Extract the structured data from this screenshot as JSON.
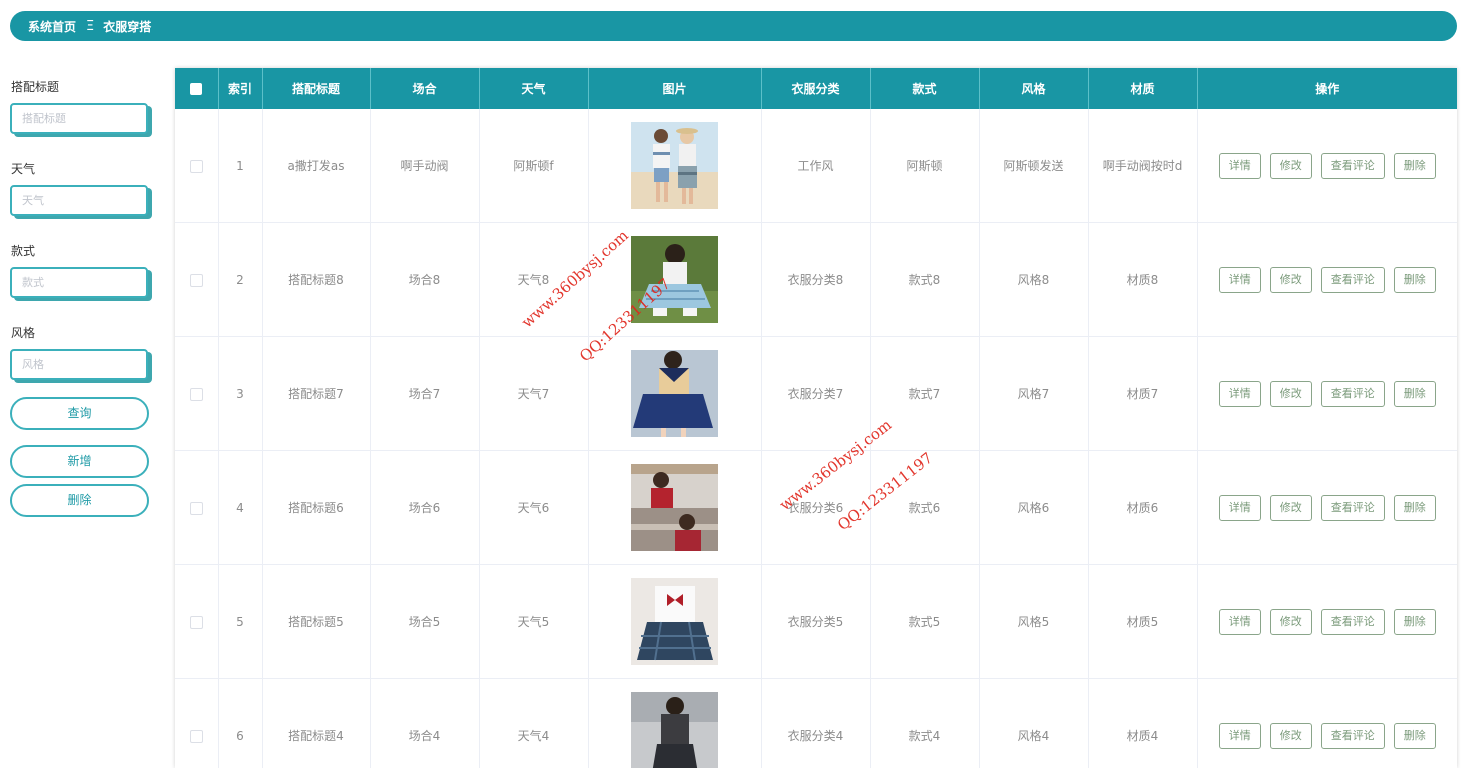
{
  "breadcrumb": {
    "home": "系统首页",
    "separator": "Ξ",
    "current": "衣服穿搭"
  },
  "filters": [
    {
      "label": "搭配标题",
      "placeholder": "搭配标题"
    },
    {
      "label": "天气",
      "placeholder": "天气"
    },
    {
      "label": "款式",
      "placeholder": "款式"
    },
    {
      "label": "风格",
      "placeholder": "风格"
    }
  ],
  "buttons": {
    "search": "查询",
    "add": "新增",
    "delete": "删除"
  },
  "table": {
    "headers": [
      "索引",
      "搭配标题",
      "场合",
      "天气",
      "图片",
      "衣服分类",
      "款式",
      "风格",
      "材质",
      "操作"
    ],
    "actions": {
      "detail": "详情",
      "edit": "修改",
      "comments": "查看评论",
      "remove": "删除"
    },
    "rows": [
      {
        "index": "1",
        "title": "a撒打发as",
        "occasion": "啊手动阀",
        "weather": "阿斯顿f",
        "category": "工作风",
        "style": "阿斯顿",
        "fashion": "阿斯顿发送",
        "material": "啊手动阀按时d",
        "image": "couple-photo"
      },
      {
        "index": "2",
        "title": "搭配标题8",
        "occasion": "场合8",
        "weather": "天气8",
        "category": "衣服分类8",
        "style": "款式8",
        "fashion": "风格8",
        "material": "材质8",
        "image": "plaid-skirt-photo"
      },
      {
        "index": "3",
        "title": "搭配标题7",
        "occasion": "场合7",
        "weather": "天气7",
        "category": "衣服分类7",
        "style": "款式7",
        "fashion": "风格7",
        "material": "材质7",
        "image": "sailor-uniform-photo"
      },
      {
        "index": "4",
        "title": "搭配标题6",
        "occasion": "场合6",
        "weather": "天气6",
        "category": "衣服分类6",
        "style": "款式6",
        "fashion": "风格6",
        "material": "材质6",
        "image": "red-uniform-photo"
      },
      {
        "index": "5",
        "title": "搭配标题5",
        "occasion": "场合5",
        "weather": "天气5",
        "category": "衣服分类5",
        "style": "款式5",
        "fashion": "风格5",
        "material": "材质5",
        "image": "bow-uniform-photo"
      },
      {
        "index": "6",
        "title": "搭配标题4",
        "occasion": "场合4",
        "weather": "天气4",
        "category": "衣服分类4",
        "style": "款式4",
        "fashion": "风格4",
        "material": "材质4",
        "image": "dark-outfit-photo"
      }
    ]
  },
  "watermarks": [
    {
      "site": "www.360bysj.com",
      "qq": "QQ:123311197"
    },
    {
      "site": "www.360bysj.com",
      "qq": "QQ:123311197"
    }
  ],
  "colors": {
    "accent": "#1996a4",
    "border": "#3bb0bb",
    "action_border": "#8aa58a"
  }
}
